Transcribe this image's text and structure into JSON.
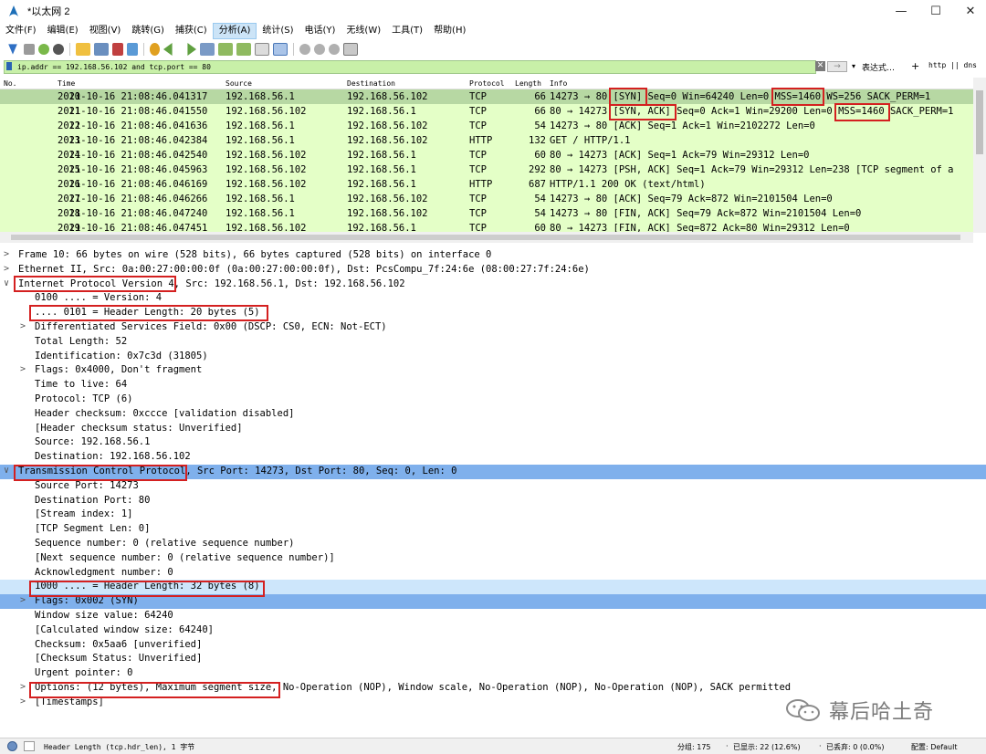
{
  "window": {
    "title": "*以太网 2",
    "min_glyph": "—",
    "max_glyph": "☐",
    "close_glyph": "✕"
  },
  "menu": [
    "文件(F)",
    "编辑(E)",
    "视图(V)",
    "跳转(G)",
    "捕获(C)",
    "分析(A)",
    "统计(S)",
    "电话(Y)",
    "无线(W)",
    "工具(T)",
    "帮助(H)"
  ],
  "menu_active": "分析(A)",
  "filter": {
    "value": "ip.addr == 192.168.56.102 and tcp.port == 80",
    "expression_label": "表达式…",
    "plus": "+",
    "buttons": "http || dns",
    "clear_glyph": "✕",
    "apply_glyph": "→",
    "dropdown_glyph": "▾"
  },
  "columns": [
    "No.",
    "Time",
    "Source",
    "Destination",
    "Protocol",
    "Length",
    "Info"
  ],
  "packets": [
    {
      "no": "10",
      "time": "2021-10-16 21:08:46.041317",
      "src": "192.168.56.1",
      "dst": "192.168.56.102",
      "proto": "TCP",
      "len": "66",
      "info": "14273 → 80 [SYN] Seq=0 Win=64240 Len=0 MSS=1460 WS=256 SACK_PERM=1"
    },
    {
      "no": "11",
      "time": "2021-10-16 21:08:46.041550",
      "src": "192.168.56.102",
      "dst": "192.168.56.1",
      "proto": "TCP",
      "len": "66",
      "info": "80 → 14273 [SYN, ACK] Seq=0 Ack=1 Win=29200 Len=0 MSS=1460 SACK_PERM=1"
    },
    {
      "no": "12",
      "time": "2021-10-16 21:08:46.041636",
      "src": "192.168.56.1",
      "dst": "192.168.56.102",
      "proto": "TCP",
      "len": "54",
      "info": "14273 → 80 [ACK] Seq=1 Ack=1 Win=2102272 Len=0"
    },
    {
      "no": "13",
      "time": "2021-10-16 21:08:46.042384",
      "src": "192.168.56.1",
      "dst": "192.168.56.102",
      "proto": "HTTP",
      "len": "132",
      "info": "GET / HTTP/1.1"
    },
    {
      "no": "14",
      "time": "2021-10-16 21:08:46.042540",
      "src": "192.168.56.102",
      "dst": "192.168.56.1",
      "proto": "TCP",
      "len": "60",
      "info": "80 → 14273 [ACK] Seq=1 Ack=79 Win=29312 Len=0"
    },
    {
      "no": "15",
      "time": "2021-10-16 21:08:46.045963",
      "src": "192.168.56.102",
      "dst": "192.168.56.1",
      "proto": "TCP",
      "len": "292",
      "info": "80 → 14273 [PSH, ACK] Seq=1 Ack=79 Win=29312 Len=238 [TCP segment of a"
    },
    {
      "no": "16",
      "time": "2021-10-16 21:08:46.046169",
      "src": "192.168.56.102",
      "dst": "192.168.56.1",
      "proto": "HTTP",
      "len": "687",
      "info": "HTTP/1.1 200 OK  (text/html)"
    },
    {
      "no": "17",
      "time": "2021-10-16 21:08:46.046266",
      "src": "192.168.56.1",
      "dst": "192.168.56.102",
      "proto": "TCP",
      "len": "54",
      "info": "14273 → 80 [ACK] Seq=79 Ack=872 Win=2101504 Len=0"
    },
    {
      "no": "18",
      "time": "2021-10-16 21:08:46.047240",
      "src": "192.168.56.1",
      "dst": "192.168.56.102",
      "proto": "TCP",
      "len": "54",
      "info": "14273 → 80 [FIN, ACK] Seq=79 Ack=872 Win=2101504 Len=0"
    },
    {
      "no": "19",
      "time": "2021-10-16 21:08:46.047451",
      "src": "192.168.56.102",
      "dst": "192.168.56.1",
      "proto": "TCP",
      "len": "60",
      "info": "80 → 14273 [FIN, ACK] Seq=872 Ack=80 Win=29312 Len=0"
    }
  ],
  "details": [
    {
      "level": 0,
      "arrow": ">",
      "text": "Frame 10: 66 bytes on wire (528 bits), 66 bytes captured (528 bits) on interface 0"
    },
    {
      "level": 0,
      "arrow": ">",
      "text": "Ethernet II, Src: 0a:00:27:00:00:0f (0a:00:27:00:00:0f), Dst: PcsCompu_7f:24:6e (08:00:27:7f:24:6e)"
    },
    {
      "level": 0,
      "arrow": "∨",
      "text": "Internet Protocol Version 4, Src: 192.168.56.1, Dst: 192.168.56.102"
    },
    {
      "level": 1,
      "arrow": "",
      "text": "0100 .... = Version: 4"
    },
    {
      "level": 1,
      "arrow": "",
      "text": ".... 0101 = Header Length: 20 bytes (5)"
    },
    {
      "level": 1,
      "arrow": ">",
      "text": "Differentiated Services Field: 0x00 (DSCP: CS0, ECN: Not-ECT)"
    },
    {
      "level": 1,
      "arrow": "",
      "text": "Total Length: 52"
    },
    {
      "level": 1,
      "arrow": "",
      "text": "Identification: 0x7c3d (31805)"
    },
    {
      "level": 1,
      "arrow": ">",
      "text": "Flags: 0x4000, Don't fragment"
    },
    {
      "level": 1,
      "arrow": "",
      "text": "Time to live: 64"
    },
    {
      "level": 1,
      "arrow": "",
      "text": "Protocol: TCP (6)"
    },
    {
      "level": 1,
      "arrow": "",
      "text": "Header checksum: 0xccce [validation disabled]"
    },
    {
      "level": 1,
      "arrow": "",
      "text": "[Header checksum status: Unverified]"
    },
    {
      "level": 1,
      "arrow": "",
      "text": "Source: 192.168.56.1"
    },
    {
      "level": 1,
      "arrow": "",
      "text": "Destination: 192.168.56.102"
    },
    {
      "level": 0,
      "arrow": "∨",
      "text": "Transmission Control Protocol, Src Port: 14273, Dst Port: 80, Seq: 0, Len: 0"
    },
    {
      "level": 1,
      "arrow": "",
      "text": "Source Port: 14273"
    },
    {
      "level": 1,
      "arrow": "",
      "text": "Destination Port: 80"
    },
    {
      "level": 1,
      "arrow": "",
      "text": "[Stream index: 1]"
    },
    {
      "level": 1,
      "arrow": "",
      "text": "[TCP Segment Len: 0]"
    },
    {
      "level": 1,
      "arrow": "",
      "text": "Sequence number: 0    (relative sequence number)"
    },
    {
      "level": 1,
      "arrow": "",
      "text": "[Next sequence number: 0    (relative sequence number)]"
    },
    {
      "level": 1,
      "arrow": "",
      "text": "Acknowledgment number: 0"
    },
    {
      "level": 1,
      "arrow": "",
      "text": "1000 .... = Header Length: 32 bytes (8)"
    },
    {
      "level": 1,
      "arrow": ">",
      "text": "Flags: 0x002 (SYN)"
    },
    {
      "level": 1,
      "arrow": "",
      "text": "Window size value: 64240"
    },
    {
      "level": 1,
      "arrow": "",
      "text": "[Calculated window size: 64240]"
    },
    {
      "level": 1,
      "arrow": "",
      "text": "Checksum: 0x5aa6 [unverified]"
    },
    {
      "level": 1,
      "arrow": "",
      "text": "[Checksum Status: Unverified]"
    },
    {
      "level": 1,
      "arrow": "",
      "text": "Urgent pointer: 0"
    },
    {
      "level": 1,
      "arrow": ">",
      "text": "Options: (12 bytes), Maximum segment size, No-Operation (NOP), Window scale, No-Operation (NOP), No-Operation (NOP), SACK permitted"
    },
    {
      "level": 1,
      "arrow": ">",
      "text": "[Timestamps]"
    }
  ],
  "status": {
    "field": "Header Length (tcp.hdr_len), 1 字节",
    "groups": "分组: 175",
    "displayed": "已显示: 22 (12.6%)",
    "dropped": "已丢弃: 0 (0.0%)",
    "profile": "配置: Default",
    "sep": "·"
  },
  "watermark": "幕后哈土奇",
  "colors": {
    "filter_ok": "#c8f0a8",
    "row_tcp": "#e4ffc7",
    "row_selected": "#b7d8a3",
    "detail_selected": "#7fb0ec",
    "annotation": "#d42020"
  }
}
